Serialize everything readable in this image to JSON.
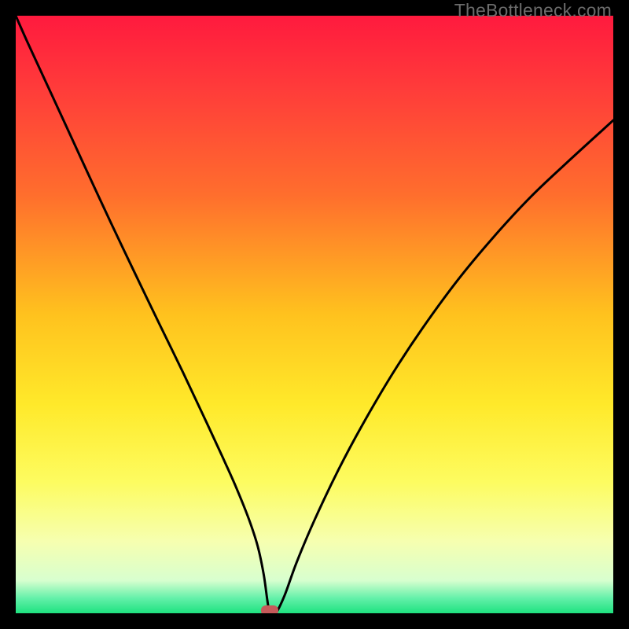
{
  "watermark": "TheBottleneck.com",
  "chart_data": {
    "type": "line",
    "title": "",
    "xlabel": "",
    "ylabel": "",
    "xlim": [
      0,
      100
    ],
    "ylim": [
      0,
      100
    ],
    "minimum_x": 42.5,
    "marker": {
      "x": 42.5,
      "y": 0,
      "color": "#c65a5a"
    },
    "gradient_stops": [
      {
        "offset": 0.0,
        "color": "#ff1a3e"
      },
      {
        "offset": 0.12,
        "color": "#ff3b3a"
      },
      {
        "offset": 0.3,
        "color": "#ff6e2d"
      },
      {
        "offset": 0.5,
        "color": "#ffc21e"
      },
      {
        "offset": 0.65,
        "color": "#ffe92a"
      },
      {
        "offset": 0.78,
        "color": "#fdfc60"
      },
      {
        "offset": 0.88,
        "color": "#f6ffb0"
      },
      {
        "offset": 0.945,
        "color": "#d8ffcf"
      },
      {
        "offset": 0.975,
        "color": "#63f0a9"
      },
      {
        "offset": 1.0,
        "color": "#1ee27f"
      }
    ],
    "series": [
      {
        "name": "curve",
        "x": [
          0.0,
          2,
          5,
          8,
          12,
          16,
          20,
          24,
          28,
          32,
          35,
          37,
          39,
          40.5,
          41.5,
          42.5,
          43.5,
          45,
          47,
          50,
          54,
          58,
          63,
          68,
          74,
          80,
          86,
          92,
          100
        ],
        "y": [
          100,
          95.5,
          89,
          82.5,
          73.8,
          65.2,
          56.8,
          48.5,
          40.3,
          31.8,
          25.3,
          20.8,
          15.8,
          11.2,
          6.5,
          0.0,
          0.0,
          3.0,
          8.5,
          15.6,
          24.0,
          31.5,
          40.0,
          47.6,
          55.8,
          63.0,
          69.5,
          75.2,
          82.5
        ]
      }
    ]
  }
}
